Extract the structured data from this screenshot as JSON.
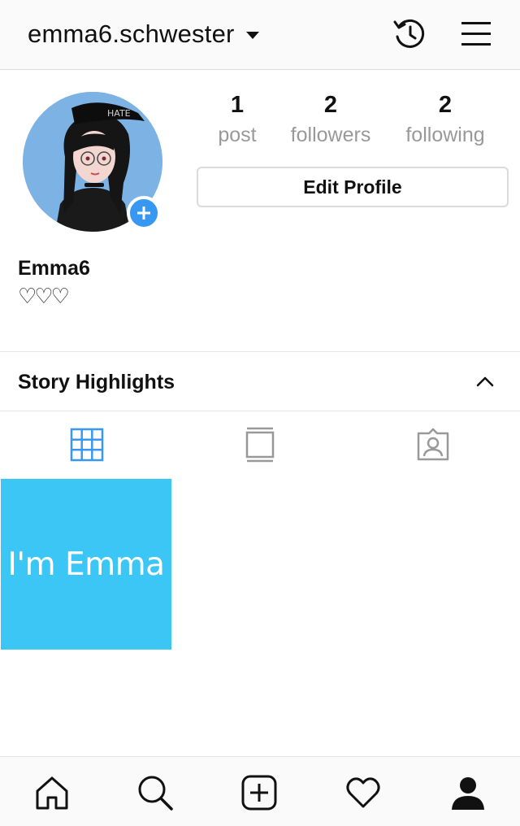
{
  "header": {
    "username": "emma6.schwester",
    "history_icon": "archive-history-icon",
    "menu_icon": "hamburger-menu-icon"
  },
  "profile": {
    "display_name": "Emma6",
    "bio": "♡♡♡",
    "stats": {
      "posts": {
        "count": "1",
        "label": "post"
      },
      "followers": {
        "count": "2",
        "label": "followers"
      },
      "following": {
        "count": "2",
        "label": "following"
      }
    },
    "edit_button": "Edit Profile",
    "avatar_badge_icon": "plus-icon"
  },
  "highlights": {
    "title": "Story Highlights",
    "state_icon": "chevron-up-icon"
  },
  "tabs": [
    {
      "name": "grid",
      "icon": "grid-icon",
      "active": true
    },
    {
      "name": "igtv",
      "icon": "igtv-icon",
      "active": false
    },
    {
      "name": "tagged",
      "icon": "tagged-icon",
      "active": false
    }
  ],
  "posts": [
    {
      "text": "I'm Emma",
      "background": "#3bc6f5"
    }
  ],
  "bottom_nav": [
    {
      "name": "home",
      "icon": "home-icon"
    },
    {
      "name": "search",
      "icon": "search-icon"
    },
    {
      "name": "new-post",
      "icon": "add-post-icon"
    },
    {
      "name": "activity",
      "icon": "heart-icon"
    },
    {
      "name": "profile",
      "icon": "profile-icon",
      "active": true
    }
  ],
  "colors": {
    "accent": "#3897f0",
    "text": "#111111",
    "muted": "#999999",
    "border": "#dbdbdb"
  }
}
